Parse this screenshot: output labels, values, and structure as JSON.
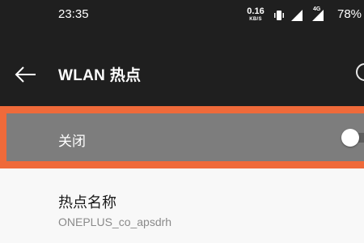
{
  "status_bar": {
    "time": "23:35",
    "net_speed_value": "0.16",
    "net_speed_unit": "KB/S",
    "network_type": "4G",
    "battery": "78%",
    "icons": [
      "vibrate-icon",
      "signal-icon",
      "signal-icon"
    ]
  },
  "app_bar": {
    "title": "WLAN 热点",
    "back_icon": "back-arrow-icon",
    "help_icon": "help-icon"
  },
  "toggle_row": {
    "label": "关闭",
    "state": "off",
    "highlight_color": "#ef6a3a"
  },
  "hotspot_name": {
    "title": "热点名称",
    "value": "ONEPLUS_co_apsdrh"
  }
}
